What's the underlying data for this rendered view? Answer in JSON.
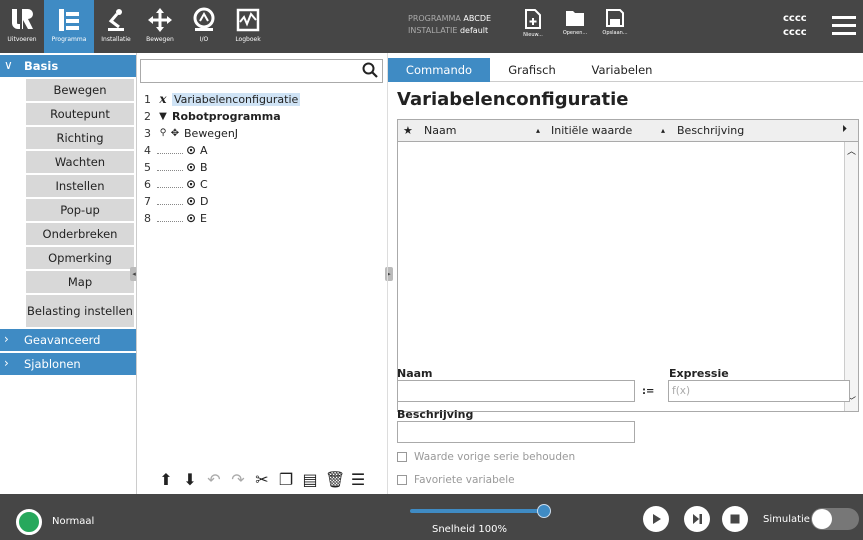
{
  "topbar": {
    "nav": [
      {
        "label": "Uitvoeren",
        "icon": "ur-logo-icon"
      },
      {
        "label": "Programma",
        "icon": "program-icon",
        "active": true
      },
      {
        "label": "Installatie",
        "icon": "robot-arm-icon"
      },
      {
        "label": "Bewegen",
        "icon": "move-icon"
      },
      {
        "label": "I/O",
        "icon": "io-icon"
      },
      {
        "label": "Logboek",
        "icon": "log-icon"
      }
    ],
    "program_label": "PROGRAMMA",
    "program_name": "ABCDE",
    "installation_label": "INSTALLATIE",
    "installation_name": "default",
    "file_buttons": [
      {
        "label": "Nieuw...",
        "icon": "new-file-icon"
      },
      {
        "label": "Openen...",
        "icon": "folder-icon"
      },
      {
        "label": "Opslaan...",
        "icon": "save-icon"
      }
    ],
    "user_line1": "cccc",
    "user_line2": "cccc",
    "menu_icon": "hamburger-menu-icon"
  },
  "left_panel": {
    "basis_label": "Basis",
    "basis_items": [
      "Bewegen",
      "Routepunt",
      "Richting",
      "Wachten",
      "Instellen",
      "Pop-up",
      "Onderbreken",
      "Opmerking",
      "Map",
      "Belasting instellen"
    ],
    "geavanceerd_label": "Geavanceerd",
    "sjablonen_label": "Sjablonen"
  },
  "tree": {
    "search_placeholder": "",
    "rows": [
      {
        "line": "1",
        "icon": "x",
        "text": "Variabelenconfiguratie"
      },
      {
        "line": "2",
        "icon": "▾",
        "text": "Robotprogramma"
      },
      {
        "line": "3",
        "icon": "✥",
        "text": "BewegenJ"
      },
      {
        "line": "4",
        "icon": "⊙",
        "text": "A"
      },
      {
        "line": "5",
        "icon": "⊙",
        "text": "B"
      },
      {
        "line": "6",
        "icon": "⊙",
        "text": "C"
      },
      {
        "line": "7",
        "icon": "⊙",
        "text": "D"
      },
      {
        "line": "8",
        "icon": "⊙",
        "text": "E"
      }
    ]
  },
  "right_panel": {
    "tabs": [
      "Commando",
      "Grafisch",
      "Variabelen"
    ],
    "title": "Variabelenconfiguratie",
    "table_headers": {
      "star": "★",
      "name": "Naam",
      "initial": "Initiële waarde",
      "description": "Beschrijving"
    },
    "form": {
      "name_label": "Naam",
      "assign_symbol": ":=",
      "expression_label": "Expressie",
      "expression_placeholder": "f(x)",
      "description_label": "Beschrijving",
      "keep_value_label": "Waarde vorige serie behouden",
      "favorite_label": "Favoriete variabele"
    }
  },
  "footer": {
    "status": "Normaal",
    "speed_label": "Snelheid 100%",
    "speed_percent": 100,
    "simulation_label": "Simulatie",
    "simulation_on": false
  },
  "colors": {
    "accent": "#3f8bc4",
    "bar": "#464646",
    "status_green": "#27a85c"
  }
}
